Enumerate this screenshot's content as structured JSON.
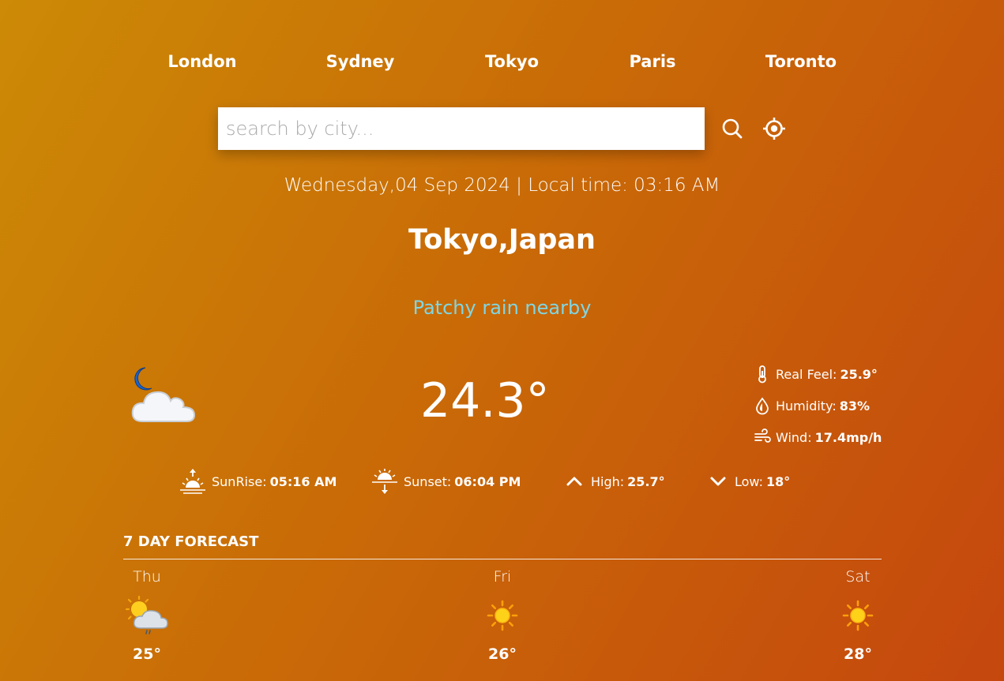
{
  "nav": {
    "cities": [
      "London",
      "Sydney",
      "Tokyo",
      "Paris",
      "Toronto"
    ]
  },
  "search": {
    "placeholder": "search by city...",
    "value": ""
  },
  "datetime": "Wednesday,04 Sep 2024 | Local time: 03:16 AM",
  "location": "Tokyo,Japan",
  "condition": "Patchy rain nearby",
  "current": {
    "icon": "moon-cloud-icon",
    "temperature": "24.3°",
    "details": {
      "real_feel_label": "Real Feel:",
      "real_feel_value": "25.9°",
      "humidity_label": "Humidity:",
      "humidity_value": "83%",
      "wind_label": "Wind:",
      "wind_value": "17.4mp/h"
    }
  },
  "stats": {
    "sunrise_label": "SunRise:",
    "sunrise_value": "05:16 AM",
    "sunset_label": "Sunset:",
    "sunset_value": "06:04 PM",
    "high_label": "High:",
    "high_value": "25.7°",
    "low_label": "Low:",
    "low_value": "18°"
  },
  "forecast": {
    "title": "7 DAY FORECAST",
    "days": [
      {
        "name": "Thu",
        "icon": "sun-rain-cloud-icon",
        "temp": "25°"
      },
      {
        "name": "Fri",
        "icon": "sun-icon",
        "temp": "26°"
      },
      {
        "name": "Sat",
        "icon": "sun-icon",
        "temp": "28°"
      }
    ]
  },
  "colors": {
    "background_start": "#cc8a06",
    "background_end": "#c5470e",
    "condition_text": "#7fd6e4"
  }
}
